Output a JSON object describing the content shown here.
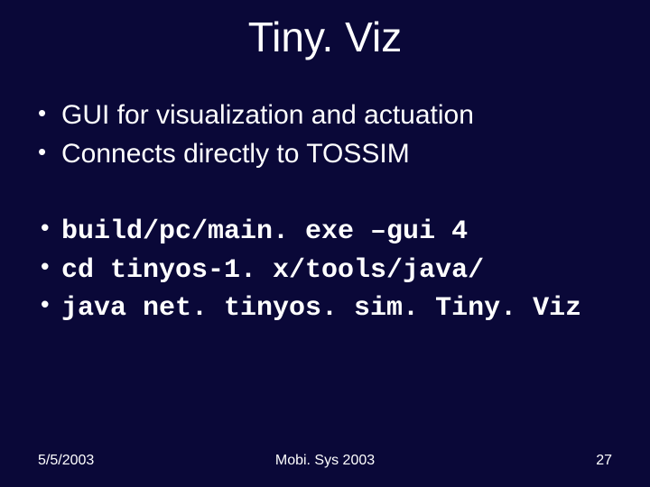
{
  "title": "Tiny. Viz",
  "bullets_a": [
    "GUI for visualization and actuation",
    "Connects directly to TOSSIM"
  ],
  "bullets_b": [
    "build/pc/main. exe –gui 4",
    "cd tinyos-1. x/tools/java/",
    "java net. tinyos. sim. Tiny. Viz"
  ],
  "footer": {
    "date": "5/5/2003",
    "venue": "Mobi. Sys 2003",
    "page": "27"
  }
}
